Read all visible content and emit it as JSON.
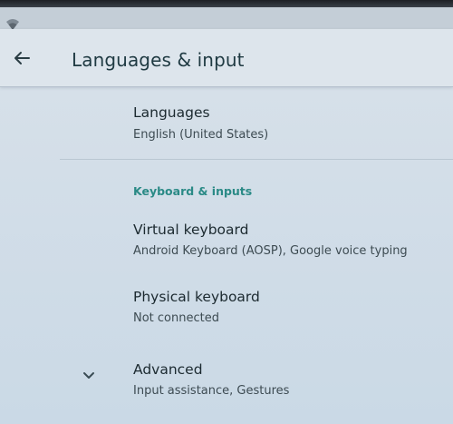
{
  "header": {
    "title": "Languages & input",
    "back_icon": "arrow-back-icon"
  },
  "status_bar": {
    "icons": [
      "wifi-icon"
    ]
  },
  "settings": {
    "languages": {
      "title": "Languages",
      "summary": "English (United States)"
    },
    "section_keyboard": "Keyboard & inputs",
    "virtual_keyboard": {
      "title": "Virtual keyboard",
      "summary": "Android Keyboard (AOSP), Google voice typing"
    },
    "physical_keyboard": {
      "title": "Physical keyboard",
      "summary": "Not connected"
    },
    "advanced": {
      "title": "Advanced",
      "summary": "Input assistance, Gestures",
      "icon": "chevron-down-icon"
    }
  },
  "colors": {
    "accent": "#2a8a86",
    "title_text": "#1f3a42",
    "background": "#d3dee8"
  }
}
